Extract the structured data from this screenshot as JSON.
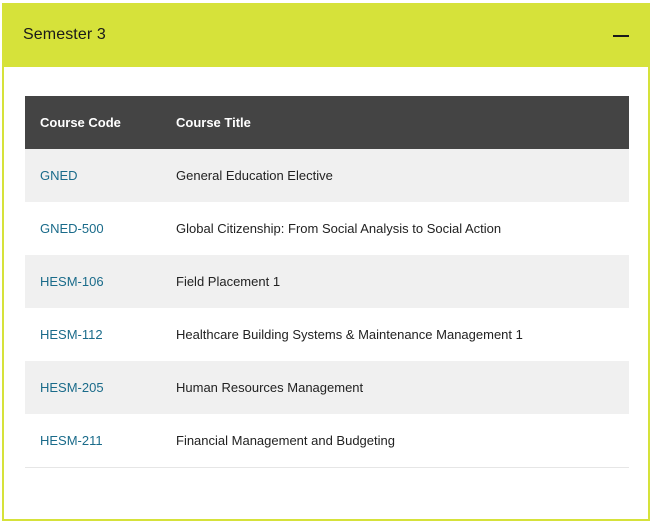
{
  "panel": {
    "title": "Semester 3",
    "collapse_icon": "minus-icon"
  },
  "table": {
    "headers": {
      "code": "Course Code",
      "title": "Course Title"
    },
    "rows": [
      {
        "code": "GNED",
        "title": "General Education Elective"
      },
      {
        "code": "GNED-500",
        "title": "Global Citizenship: From Social Analysis to Social Action"
      },
      {
        "code": "HESM-106",
        "title": "Field Placement 1"
      },
      {
        "code": "HESM-112",
        "title": "Healthcare Building Systems & Maintenance Management 1"
      },
      {
        "code": "HESM-205",
        "title": "Human Resources Management"
      },
      {
        "code": "HESM-211",
        "title": "Financial Management and Budgeting"
      }
    ]
  },
  "colors": {
    "accent": "#d6e23a",
    "header_bg": "#444444",
    "link": "#1a6b8a",
    "row_alt": "#f0f0f0"
  }
}
